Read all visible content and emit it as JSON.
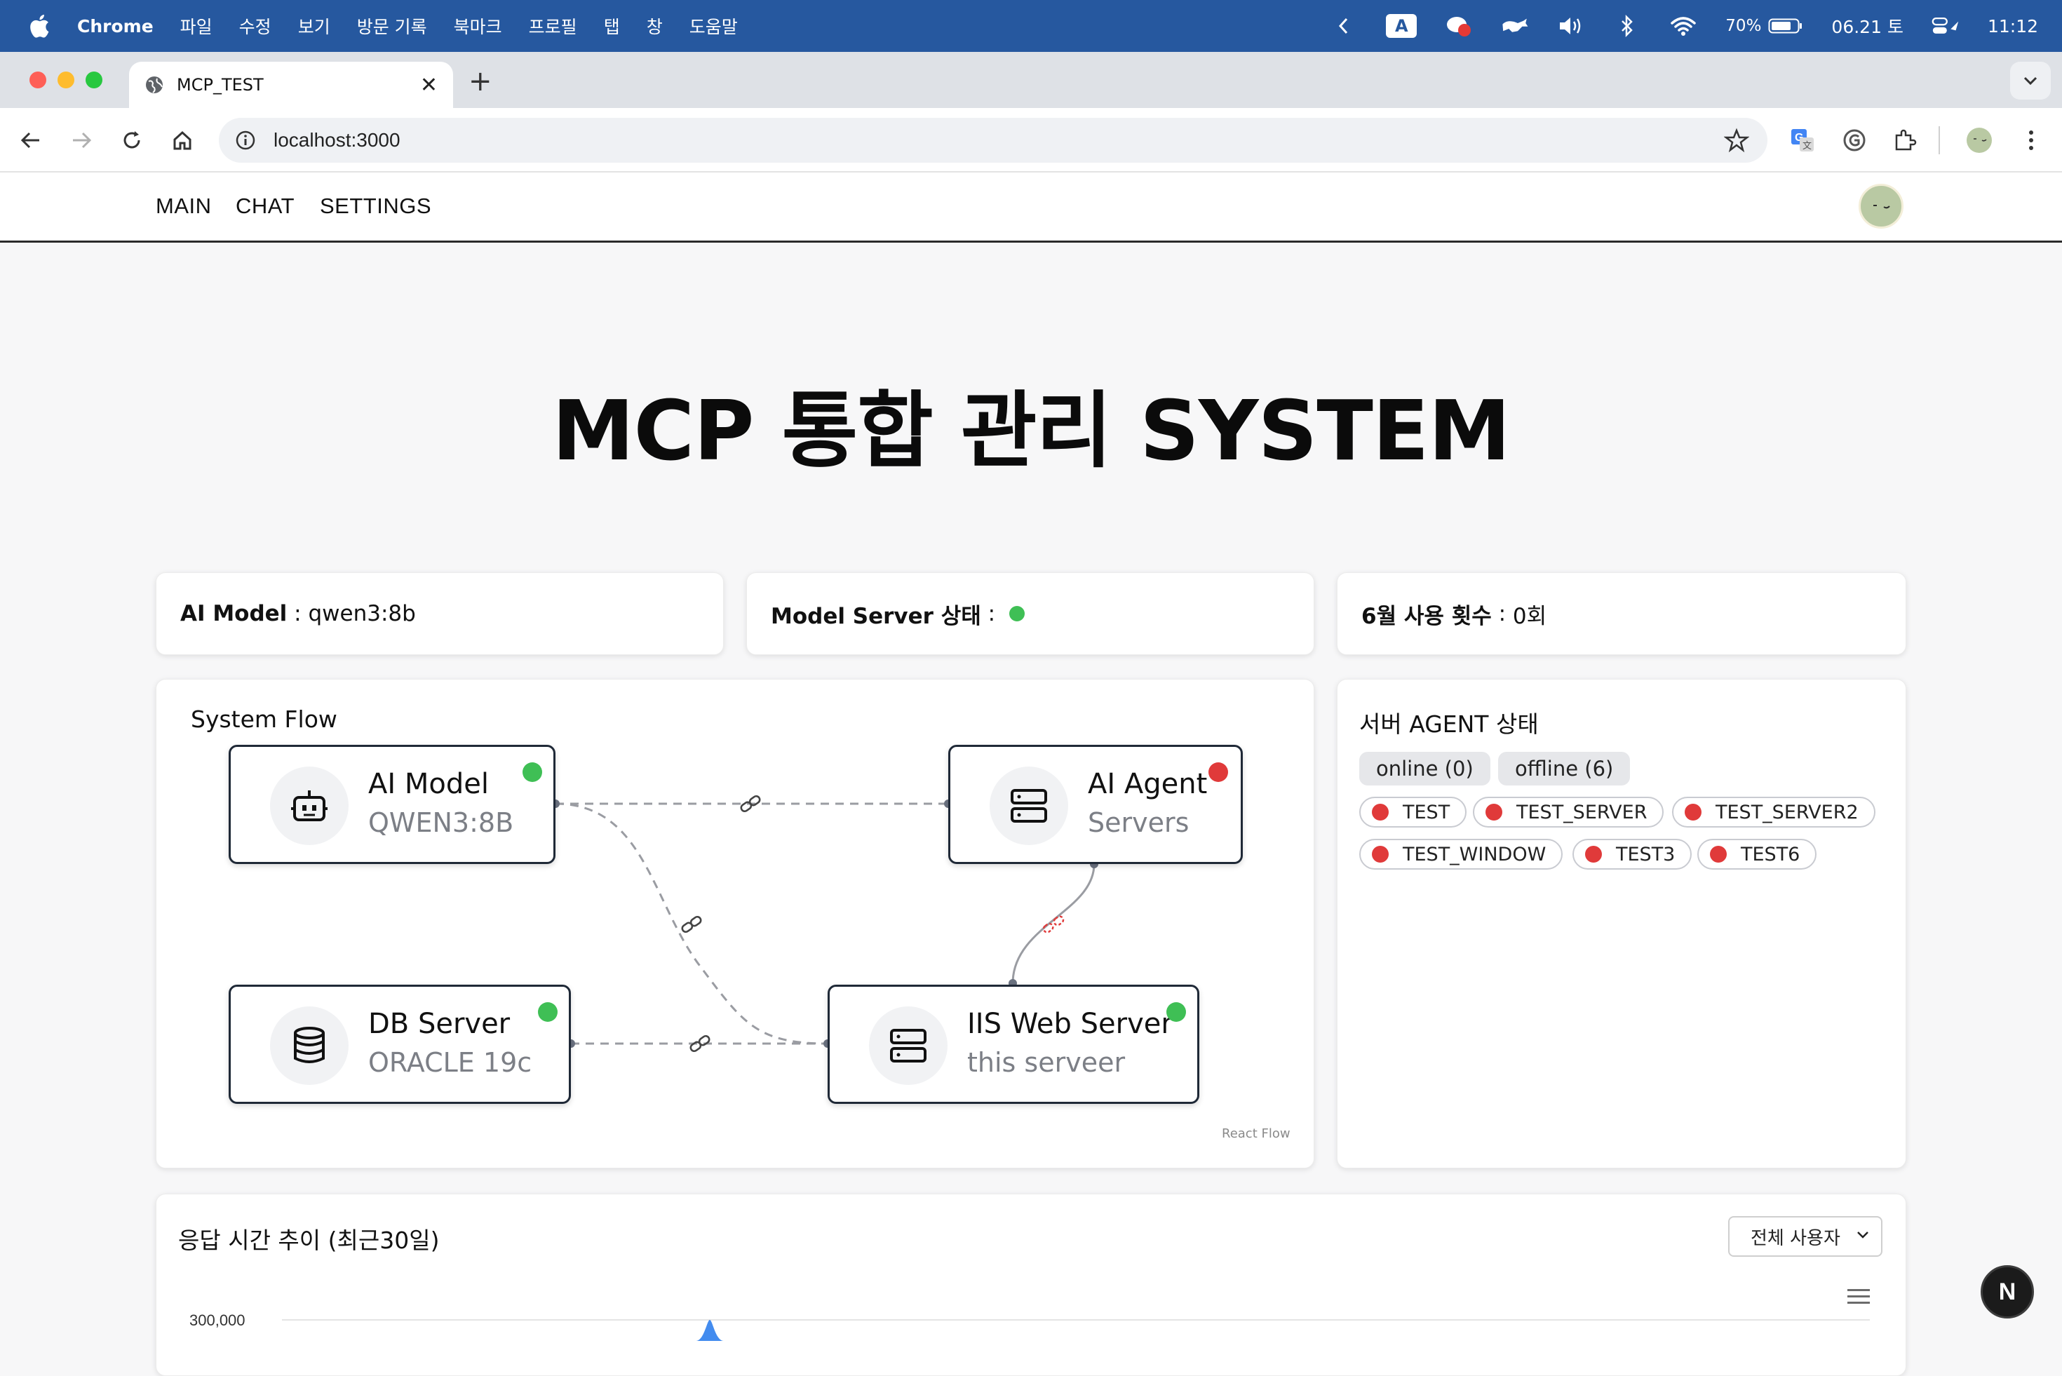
{
  "menubar": {
    "app": "Chrome",
    "items": [
      "파일",
      "수정",
      "보기",
      "방문 기록",
      "북마크",
      "프로필",
      "탭",
      "창",
      "도움말"
    ],
    "input_badge": "A",
    "battery": "70%",
    "date": "06.21 토",
    "time": "11:12"
  },
  "browser": {
    "tab_title": "MCP_TEST",
    "url": "localhost:3000"
  },
  "nav": {
    "links": [
      "MAIN",
      "CHAT",
      "SETTINGS"
    ]
  },
  "page": {
    "title": "MCP 통합 관리 SYSTEM"
  },
  "info": {
    "model_label": "AI Model",
    "model_value": "qwen3:8b",
    "server_label": "Model Server 상태",
    "server_status_color": "#3fbf55",
    "usage_label": "6월 사용 횟수",
    "usage_value": "0회"
  },
  "flow": {
    "title": "System Flow",
    "credit": "React Flow",
    "nodes": {
      "ai_model": {
        "title": "AI Model",
        "sub": "QWEN3:8B",
        "status_color": "#3fbf55"
      },
      "ai_agent": {
        "title": "AI Agent",
        "sub": "Servers",
        "status_color": "#e03a3a"
      },
      "db_server": {
        "title": "DB Server",
        "sub": "ORACLE 19c",
        "status_color": "#3fbf55"
      },
      "iis_server": {
        "title": "IIS Web Server",
        "sub": "this serveer",
        "status_color": "#3fbf55"
      }
    }
  },
  "agents": {
    "title": "서버 AGENT 상태",
    "online": "online (0)",
    "offline": "offline (6)",
    "list": [
      "TEST",
      "TEST_SERVER",
      "TEST_SERVER2",
      "TEST_WINDOW",
      "TEST3",
      "TEST6"
    ],
    "offline_color": "#e03a3a"
  },
  "chart": {
    "title": "응답 시간 추이 (최근30일)",
    "filter": "전체 사용자",
    "ytick_top": "300,000"
  },
  "badge": "N"
}
